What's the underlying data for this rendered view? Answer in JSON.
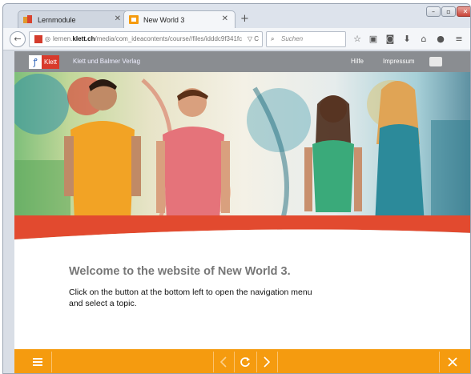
{
  "browser": {
    "tabs": [
      {
        "label": "Lernmodule",
        "active": false
      },
      {
        "label": "New World 3",
        "active": true
      }
    ],
    "url": {
      "prefix": "lernen.",
      "host": "klett.ch",
      "path": "/media/com_ideacontents/course//files/idddc9f341fc",
      "tail": "▽ C"
    },
    "search_placeholder": "Suchen"
  },
  "site": {
    "logo_text": "Klett",
    "publisher": "Klett und Balmer Verlag",
    "header_links": [
      "Hilfe",
      "Impressum"
    ]
  },
  "content": {
    "welcome": "Welcome to the website of New World 3.",
    "instructions": "Click on the button at the bottom left to open the navigation menu and select a topic."
  },
  "colors": {
    "accent_orange": "#f59b0f",
    "header_gray": "#8a8d91",
    "brand_red": "#d83a2c"
  },
  "icons": {
    "menu": "hamburger-icon",
    "prev": "chevron-left-icon",
    "reload": "reload-icon",
    "next": "chevron-right-icon",
    "close": "close-icon"
  }
}
